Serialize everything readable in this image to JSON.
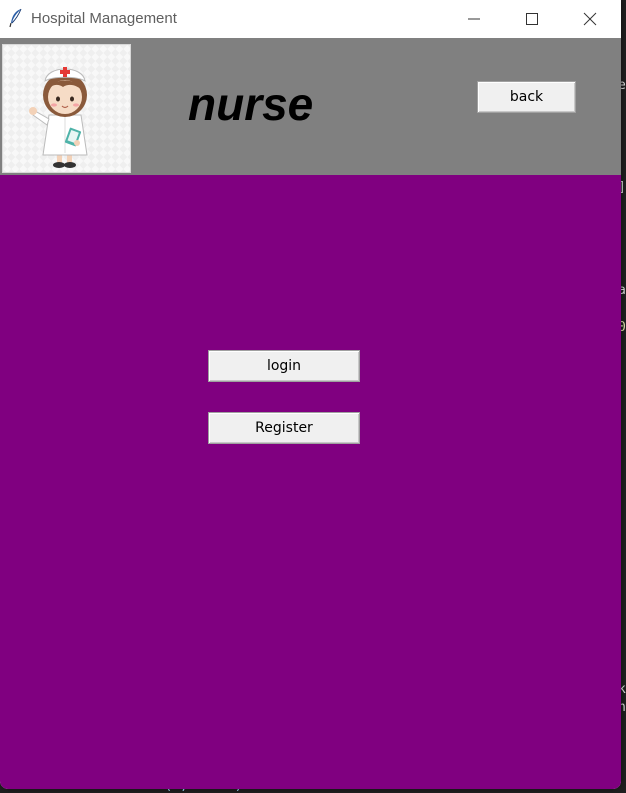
{
  "window": {
    "title": "Hospital Management"
  },
  "header": {
    "title": "nurse",
    "back_label": "back",
    "avatar_icon": "nurse-avatar-icon"
  },
  "main": {
    "login_label": "login",
    "register_label": "Register",
    "background_color": "#800080"
  },
  "colors": {
    "header_bg": "#808080",
    "content_bg": "#800080"
  },
  "background": {
    "code_line": "     self.lst1.insert(0, dname)"
  }
}
